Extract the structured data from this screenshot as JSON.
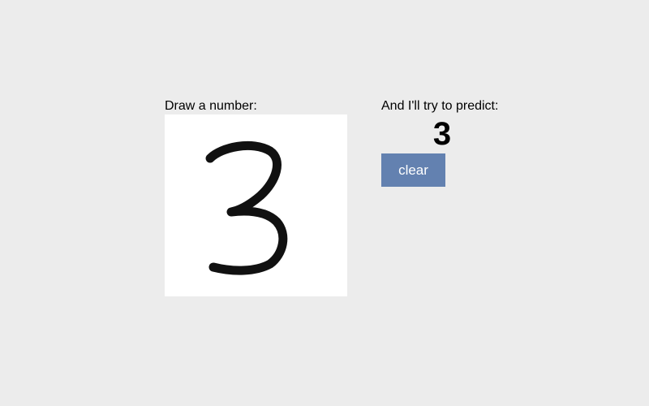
{
  "draw": {
    "label": "Draw a number:"
  },
  "predict": {
    "label": "And I'll try to predict:",
    "value": "3"
  },
  "controls": {
    "clear_label": "clear"
  },
  "colors": {
    "background": "#ececec",
    "canvas": "#ffffff",
    "ink": "#111111",
    "button": "#6381b0",
    "button_text": "#ffffff"
  }
}
